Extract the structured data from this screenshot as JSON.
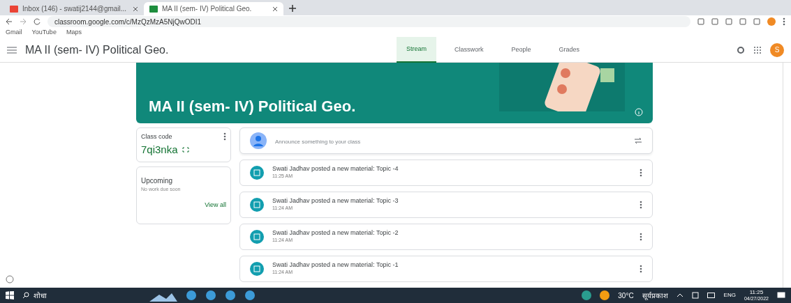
{
  "browser": {
    "tabs": [
      {
        "title": "Inbox (146) - swatij2144@gmail...",
        "selected": false
      },
      {
        "title": "MA II (sem- IV) Political Geo.",
        "selected": true
      }
    ],
    "url": "classroom.google.com/c/MzQzMzA5NjQwODI1",
    "bookmarks": [
      "Gmail",
      "YouTube",
      "Maps"
    ]
  },
  "app_bar": {
    "title": "MA II (sem- IV) Political Geo.",
    "avatar": "S",
    "tabs": [
      {
        "label": "Stream",
        "selected": true
      },
      {
        "label": "Classwork",
        "selected": false
      },
      {
        "label": "People",
        "selected": false
      },
      {
        "label": "Grades",
        "selected": false
      }
    ]
  },
  "banner": {
    "title": "MA II (sem- IV) Political Geo."
  },
  "class_code": {
    "label": "Class code",
    "code": "7qi3nka"
  },
  "upcoming": {
    "title": "Upcoming",
    "message": "No work due soon",
    "link": "View all"
  },
  "announce": {
    "placeholder": "Announce something to your class"
  },
  "posts": [
    {
      "text": "Swati Jadhav posted a new material: Topic -4",
      "time": "11:25 AM"
    },
    {
      "text": "Swati Jadhav posted a new material: Topic -3",
      "time": "11:24 AM"
    },
    {
      "text": "Swati Jadhav posted a new material: Topic -2",
      "time": "11:24 AM"
    },
    {
      "text": "Swati Jadhav posted a new material: Topic -1",
      "time": "11:24 AM"
    }
  ],
  "taskbar": {
    "search": "शोधा",
    "weather": "30°C",
    "weather_text": "सूर्यप्रकाश",
    "language": "ENG",
    "time": "11:25",
    "date": "04/27/2022"
  }
}
